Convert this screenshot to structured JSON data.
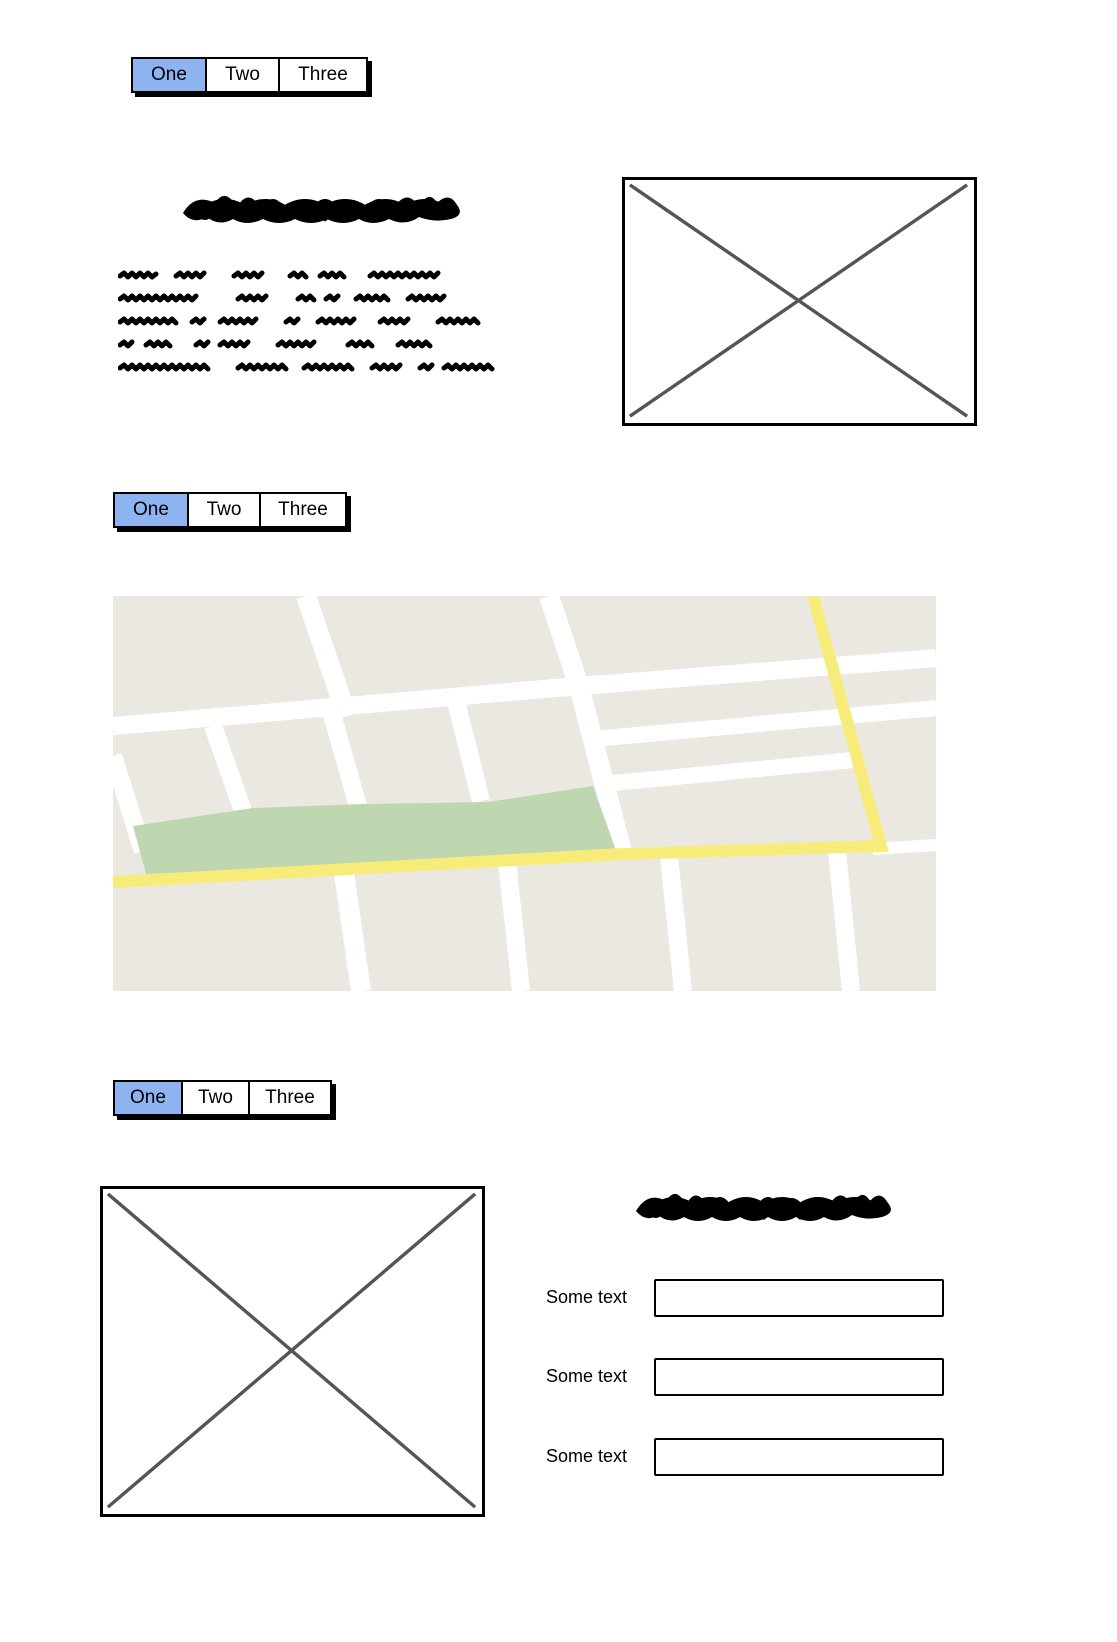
{
  "tabs_top": {
    "items": [
      {
        "label": "One"
      },
      {
        "label": "Two"
      },
      {
        "label": "Three"
      }
    ],
    "active": "One"
  },
  "tabs_middle": {
    "items": [
      {
        "label": "One"
      },
      {
        "label": "Two"
      },
      {
        "label": "Three"
      }
    ],
    "active": "One"
  },
  "tabs_bottom": {
    "items": [
      {
        "label": "One"
      },
      {
        "label": "Two"
      },
      {
        "label": "Three"
      }
    ],
    "active": "One"
  },
  "form": {
    "fields": [
      {
        "label": "Some text",
        "value": ""
      },
      {
        "label": "Some text",
        "value": ""
      },
      {
        "label": "Some text",
        "value": ""
      }
    ]
  },
  "colors": {
    "active_tab": "#8db4f0",
    "map_block": "#ebe8e2",
    "map_road": "#ffffff",
    "map_highlight_road": "#f7ec7a",
    "map_park": "#bed7b0"
  },
  "icons": [
    "image-placeholder-icon",
    "map-icon"
  ]
}
